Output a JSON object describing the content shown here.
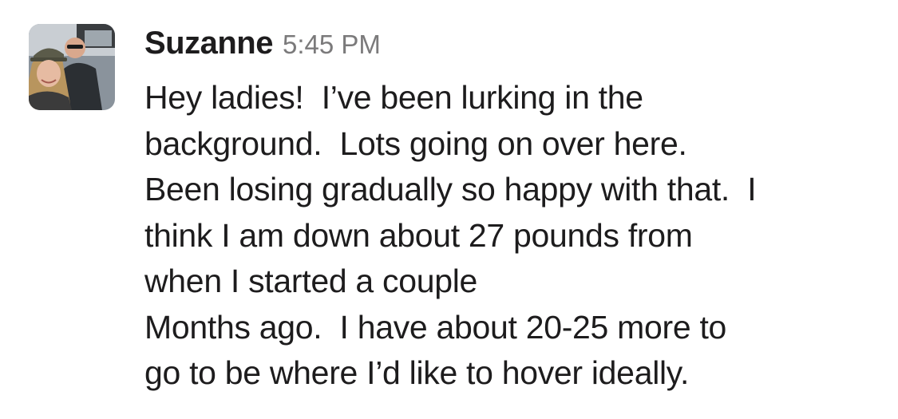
{
  "message": {
    "author": "Suzanne",
    "timestamp": "5:45 PM",
    "avatar_icon": "user-avatar-photo",
    "lines": [
      "Hey ladies!  I’ve been lurking in the",
      "background.  Lots going on over here.",
      "Been losing gradually so happy with that.  I",
      "think I am down about 27 pounds from",
      "when I started a couple",
      "Months ago.  I have about 20-25 more to",
      "go to be where I’d like to hover ideally."
    ]
  }
}
